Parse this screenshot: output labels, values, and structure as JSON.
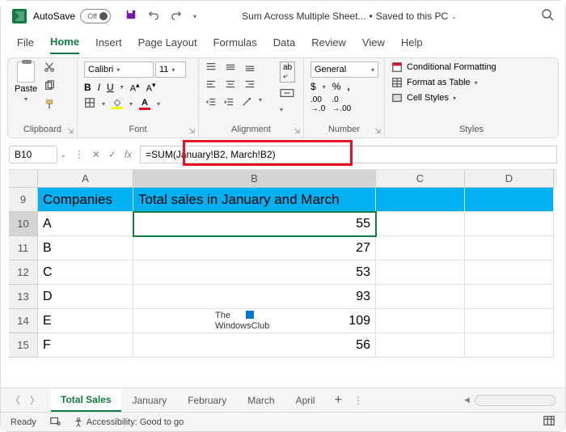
{
  "titlebar": {
    "autosave_label": "AutoSave",
    "autosave_state": "Off",
    "doc_name": "Sum Across Multiple Sheet...",
    "save_status": "Saved to this PC"
  },
  "tabs": [
    "File",
    "Home",
    "Insert",
    "Page Layout",
    "Formulas",
    "Data",
    "Review",
    "View",
    "Help"
  ],
  "active_tab": "Home",
  "ribbon": {
    "clipboard": {
      "paste": "Paste",
      "label": "Clipboard"
    },
    "font": {
      "name": "Calibri",
      "size": "11",
      "label": "Font"
    },
    "alignment": {
      "label": "Alignment"
    },
    "number": {
      "format": "General",
      "label": "Number"
    },
    "styles": {
      "conditional": "Conditional Formatting",
      "table": "Format as Table",
      "cell": "Cell Styles",
      "label": "Styles"
    }
  },
  "formula_bar": {
    "cell_ref": "B10",
    "formula": "=SUM(January!B2, March!B2)"
  },
  "columns": [
    "A",
    "B",
    "C",
    "D"
  ],
  "rows": [
    {
      "num": "9",
      "a": "Companies",
      "b": "Total sales in January and March",
      "header": true
    },
    {
      "num": "10",
      "a": "A",
      "b": "55",
      "active": true
    },
    {
      "num": "11",
      "a": "B",
      "b": "27"
    },
    {
      "num": "12",
      "a": "C",
      "b": "53"
    },
    {
      "num": "13",
      "a": "D",
      "b": "93"
    },
    {
      "num": "14",
      "a": "E",
      "b": "109"
    },
    {
      "num": "15",
      "a": "F",
      "b": "56"
    }
  ],
  "watermark": {
    "line1": "The",
    "line2": "WindowsClub"
  },
  "sheet_tabs": [
    "Total Sales",
    "January",
    "February",
    "March",
    "April"
  ],
  "active_sheet": "Total Sales",
  "status": {
    "ready": "Ready",
    "accessibility": "Accessibility: Good to go"
  }
}
